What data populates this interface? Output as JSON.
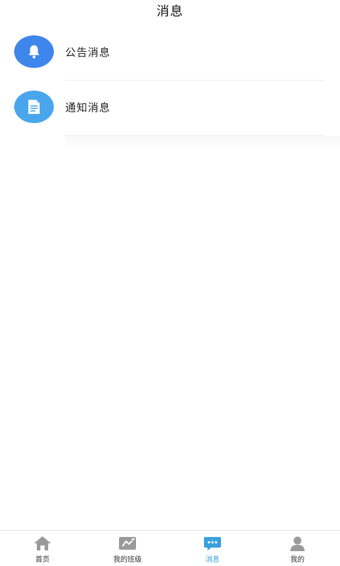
{
  "header": {
    "title": "消息"
  },
  "messages": {
    "items": [
      {
        "label": "公告消息",
        "icon": "bell-icon",
        "color": "#3f86ec"
      },
      {
        "label": "通知消息",
        "icon": "document-icon",
        "color": "#4aa6ec"
      }
    ]
  },
  "tabbar": {
    "active_color": "#3aa0dd",
    "inactive_color": "#9a9a9a",
    "tabs": [
      {
        "label": "首页",
        "icon": "home-icon",
        "active": false
      },
      {
        "label": "我的班级",
        "icon": "class-icon",
        "active": false
      },
      {
        "label": "消息",
        "icon": "chat-icon",
        "active": true
      },
      {
        "label": "我的",
        "icon": "user-icon",
        "active": false
      }
    ]
  }
}
